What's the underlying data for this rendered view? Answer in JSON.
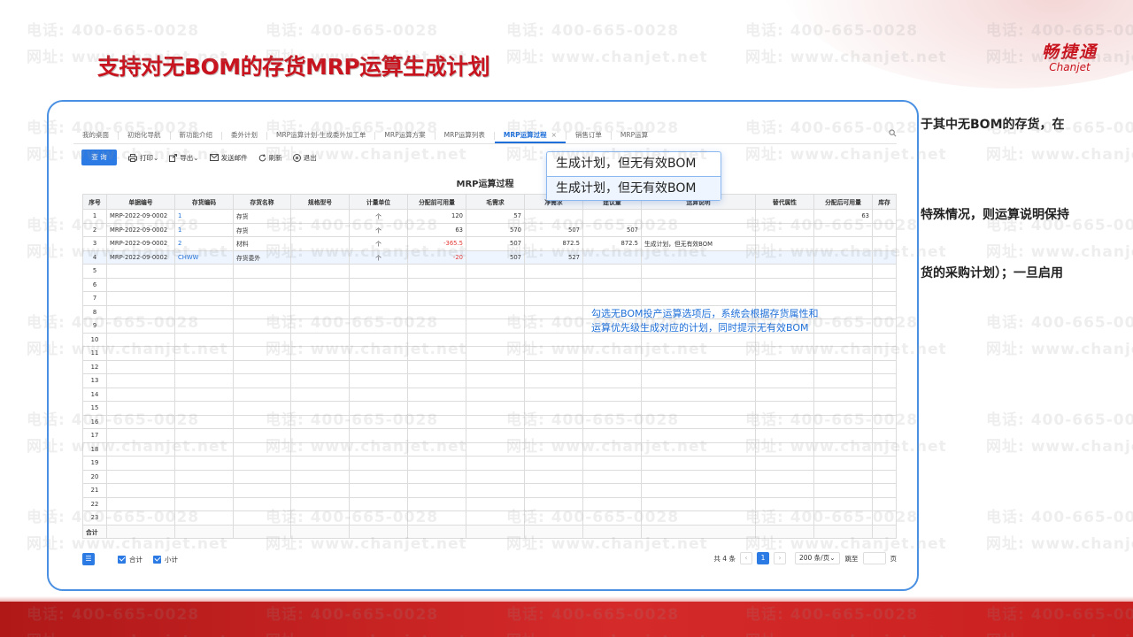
{
  "slide": {
    "title": "支持对无BOM的存货MRP运算生成计划",
    "logo_cn": "畅捷通",
    "logo_en": "Chanjet",
    "side_texts": [
      "于其中无BOM的存货，在",
      "特殊情况，则运算说明保持",
      "货的采购计划）；一旦启用"
    ],
    "watermark_phone": "电话: 400-665-0028",
    "watermark_site": "网址: www.chanjet.net"
  },
  "app": {
    "tabs": [
      {
        "label": "我的桌面"
      },
      {
        "label": "初始化导航"
      },
      {
        "label": "新功能介绍"
      },
      {
        "label": "委外计划"
      },
      {
        "label": "MRP运算计划-生成委外加工单"
      },
      {
        "label": "MRP运算方案"
      },
      {
        "label": "MRP运算列表"
      },
      {
        "label": "MRP运算过程",
        "active": true,
        "close": "×"
      },
      {
        "label": "销售订单"
      },
      {
        "label": "MRP运算"
      }
    ],
    "toolbar": {
      "query": "查 询",
      "print": "打印",
      "export": "导出",
      "email": "发送邮件",
      "refresh": "刷新",
      "exit": "退出"
    },
    "grid_title": "MRP运算过程",
    "columns": [
      "序号",
      "单据编号",
      "存货编码",
      "存货名称",
      "规格型号",
      "计量单位",
      "分配前可用量",
      "毛需求",
      "净需求",
      "建议量",
      "运算说明",
      "替代属性",
      "分配后可用量",
      "库存"
    ],
    "rows": [
      {
        "no": "1",
        "doc": "MRP-2022-09-0002",
        "code": "1",
        "name": "存货",
        "spec": "",
        "unit": "个",
        "before": "120",
        "gross": "57",
        "net": "",
        "suggest": "",
        "desc": "",
        "alt": "",
        "after": "63",
        "stock": ""
      },
      {
        "no": "2",
        "doc": "MRP-2022-09-0002",
        "code": "1",
        "name": "存货",
        "spec": "",
        "unit": "个",
        "before": "63",
        "gross": "570",
        "net": "507",
        "suggest": "507",
        "desc": "",
        "alt": "",
        "after": "",
        "stock": ""
      },
      {
        "no": "3",
        "doc": "MRP-2022-09-0002",
        "code": "2",
        "name": "材料",
        "spec": "",
        "unit": "个",
        "before": "-365.5",
        "gross": "507",
        "net": "872.5",
        "suggest": "872.5",
        "desc": "生成计划，但无有效BOM",
        "alt": "",
        "after": "",
        "stock": ""
      },
      {
        "no": "4",
        "doc": "MRP-2022-09-0002",
        "code": "CHWW",
        "name": "存货委外",
        "spec": "",
        "unit": "个",
        "before": "-20",
        "gross": "507",
        "net": "527",
        "suggest": "",
        "desc": "",
        "alt": "",
        "after": "",
        "stock": ""
      }
    ],
    "empty_rows": [
      "5",
      "6",
      "7",
      "8",
      "9",
      "10",
      "11",
      "12",
      "13",
      "14",
      "15",
      "16",
      "17",
      "18",
      "19",
      "20",
      "21",
      "22",
      "23"
    ],
    "total_label": "合计",
    "bottom": {
      "total_chk": "合计",
      "subtotal_chk": "小计",
      "count": "共 4 条",
      "current_page": "1",
      "page_size": "200 条/页",
      "jump_label": "跳至",
      "page_unit": "页"
    }
  },
  "callout": {
    "line1": "生成计划，但无有效BOM",
    "line2": "生成计划，但无有效BOM"
  },
  "note": {
    "line1": "勾选无BOM投产运算选项后，系统会根据存货属性和",
    "line2": "运算优先级生成对应的计划，同时提示无有效BOM"
  },
  "colors": {
    "accent": "#2c7be5",
    "title_red": "#c8141e",
    "negative": "#e53935"
  }
}
